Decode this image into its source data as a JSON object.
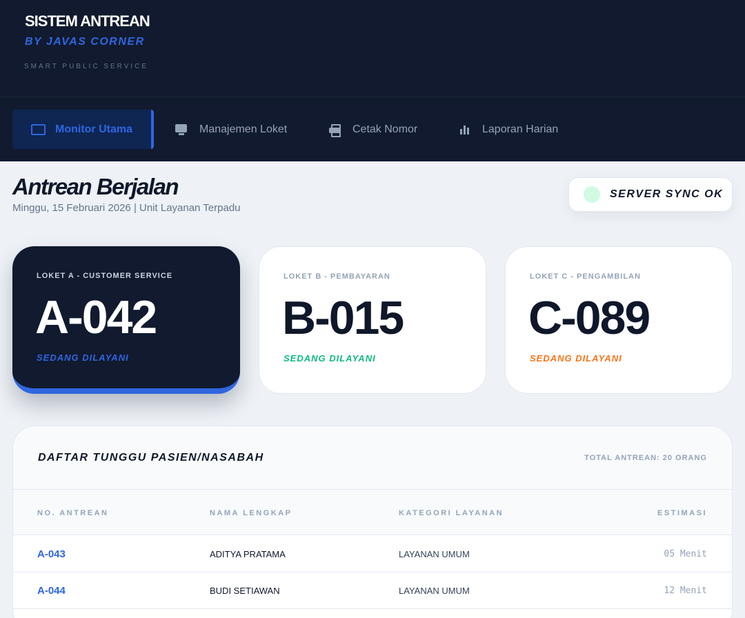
{
  "brand": {
    "title": "SISTEM ANTREAN",
    "subtitle": "BY JAVAS CORNER",
    "tagline": "SMART PUBLIC SERVICE"
  },
  "nav": {
    "items": [
      {
        "label": "Monitor Utama",
        "icon": "monitor-icon",
        "active": true
      },
      {
        "label": "Manajemen Loket",
        "icon": "desktop-icon",
        "active": false
      },
      {
        "label": "Cetak Nomor",
        "icon": "printer-icon",
        "active": false
      },
      {
        "label": "Laporan Harian",
        "icon": "bar-chart-icon",
        "active": false
      }
    ]
  },
  "main": {
    "title": "Antrean Berjalan",
    "subtitle": "Minggu, 15 Februari 2026 | Unit Layanan Terpadu",
    "sync_status": "SERVER SYNC OK"
  },
  "counters": [
    {
      "label": "LOKET A - CUSTOMER SERVICE",
      "number": "A-042",
      "status": "SEDANG DILAYANI",
      "status_color": "#2f66e0"
    },
    {
      "label": "LOKET B - PEMBAYARAN",
      "number": "B-015",
      "status": "SEDANG DILAYANI",
      "status_color": "#10b981"
    },
    {
      "label": "LOKET C - PENGAMBILAN",
      "number": "C-089",
      "status": "SEDANG DILAYANI",
      "status_color": "#f97316"
    }
  ],
  "queue": {
    "title": "DAFTAR TUNGGU PASIEN/NASABAH",
    "total": "TOTAL ANTREAN: 20 ORANG",
    "columns": [
      "NO. ANTREAN",
      "NAMA LENGKAP",
      "KATEGORI LAYANAN",
      "ESTIMASI"
    ],
    "rows": [
      {
        "no": "A-043",
        "name": "ADITYA PRATAMA",
        "category": "LAYANAN UMUM",
        "eta": "05 Menit"
      },
      {
        "no": "A-044",
        "name": "BUDI SETIAWAN",
        "category": "LAYANAN UMUM",
        "eta": "12 Menit"
      }
    ]
  },
  "colors": {
    "accent": "#2f66e0",
    "navy": "#111a2e"
  }
}
